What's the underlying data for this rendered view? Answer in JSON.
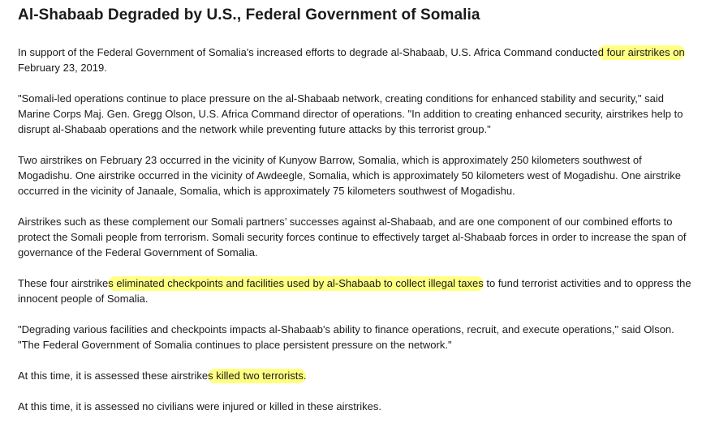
{
  "title": "Al-Shabaab Degraded by U.S., Federal Government of Somalia",
  "highlight_color": "#ffff50",
  "paragraphs": {
    "p1": {
      "a": "In support of the Federal Government of Somalia's increased efforts to degrade al-Shabaab, U.S. Africa Command conducte",
      "hl": "d four airstrikes on",
      "b": " February 23, 2019."
    },
    "p2": "\"Somali-led operations continue to place pressure on the al-Shabaab network, creating conditions for enhanced stability and security,\" said Marine Corps Maj. Gen. Gregg Olson, U.S. Africa Command director of operations.  \"In addition to creating enhanced security, airstrikes help to disrupt al-Shabaab operations and the network while preventing future attacks by this terrorist group.\"",
    "p3": "Two airstrikes on February 23 occurred in the vicinity of Kunyow Barrow, Somalia, which is approximately 250 kilometers southwest of Mogadishu.  One airstrike occurred in the vicinity of Awdeegle, Somalia, which is approximately 50 kilometers west of Mogadishu.  One airstrike occurred in the vicinity of Janaale, Somalia, which is approximately 75 kilometers southwest of Mogadishu.",
    "p4": "Airstrikes such as these complement our Somali partners’ successes against al-Shabaab, and are one component of our combined efforts to protect the Somali people from terrorism.  Somali security forces continue to effectively target al-Shabaab forces in order to increase the span of governance of the Federal Government of Somalia.",
    "p5": {
      "a": "These four airstrike",
      "hl": "s eliminated checkpoints and facilities used by al-Shabaab to collect illegal taxes",
      "b": " to fund terrorist activities and to oppress the innocent people of Somalia."
    },
    "p6": "\"Degrading various facilities and checkpoints impacts al-Shabaab's ability to finance operations, recruit, and execute operations,\" said Olson. \"The Federal Government of Somalia continues to place persistent pressure on the network.\"",
    "p7": {
      "a": "At this time, it is assessed these airstrike",
      "hl": "s killed two terrorists.",
      "b": ""
    },
    "p8": "At this time, it is assessed no civilians were injured or killed in these airstrikes."
  }
}
